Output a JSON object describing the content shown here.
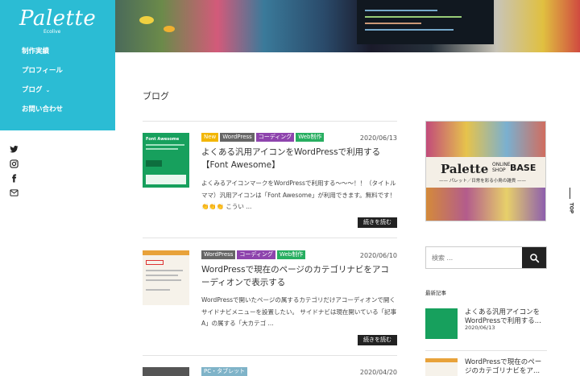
{
  "site": {
    "logo": "Palette",
    "logo_sub": "Ecolive"
  },
  "nav": [
    {
      "label": "制作実績"
    },
    {
      "label": "プロフィール"
    },
    {
      "label": "ブログ",
      "chevron": "⌄"
    },
    {
      "label": "お問い合わせ"
    }
  ],
  "social_icons": [
    "twitter-icon",
    "instagram-icon",
    "facebook-icon",
    "mail-icon"
  ],
  "page_title": "ブログ",
  "posts": [
    {
      "tags": [
        {
          "label": "New",
          "color": "#f2b600"
        },
        {
          "label": "WordPress",
          "color": "#666666"
        },
        {
          "label": "コーディング",
          "color": "#8e44ad"
        },
        {
          "label": "Web制作",
          "color": "#27ae60"
        }
      ],
      "date": "2020/06/13",
      "title": "よくある汎用アイコンをWordPressで利用する【Font Awesome】",
      "excerpt": "よくみるアイコンマークをWordPressで利用する〜〜〜！！（タイトルママ）汎用アイコンは「Font Awesome」が利用できます。無料です！👏👏👏 こうい ...",
      "more": "続きを読む",
      "thumb_text": "Font Awesome"
    },
    {
      "tags": [
        {
          "label": "WordPress",
          "color": "#666666"
        },
        {
          "label": "コーディング",
          "color": "#8e44ad"
        },
        {
          "label": "Web制作",
          "color": "#27ae60"
        }
      ],
      "date": "2020/06/10",
      "title": "WordPressで現在のページのカテゴリナビをアコーディオンで表示する",
      "excerpt": "WordPressで開いたページの属するカテゴリだけアコーディオンで開くサイドナビメニューを設置したい。 サイドナビは現在開いている「記事A」の属する「大カテゴ ...",
      "more": "続きを読む"
    },
    {
      "tags": [
        {
          "label": "PC・タブレット",
          "color": "#7fb3c8"
        }
      ],
      "date": "2020/04/20"
    }
  ],
  "banner": {
    "logo": "Palette",
    "shop_line1": "ONLINE",
    "shop_line2": "SHOP",
    "base": "BASE",
    "sub": "—— パレット／日常を彩る小鳥の雑貨 ——"
  },
  "search": {
    "placeholder": "検索 ..."
  },
  "recent_heading": "最新記事",
  "recent": [
    {
      "title": "よくある汎用アイコンをWordPressで利用する...",
      "date": "2020/06/13"
    },
    {
      "title": "WordPressで現在のページのカテゴリナビをア...",
      "date": ""
    }
  ],
  "totop": "TOP"
}
